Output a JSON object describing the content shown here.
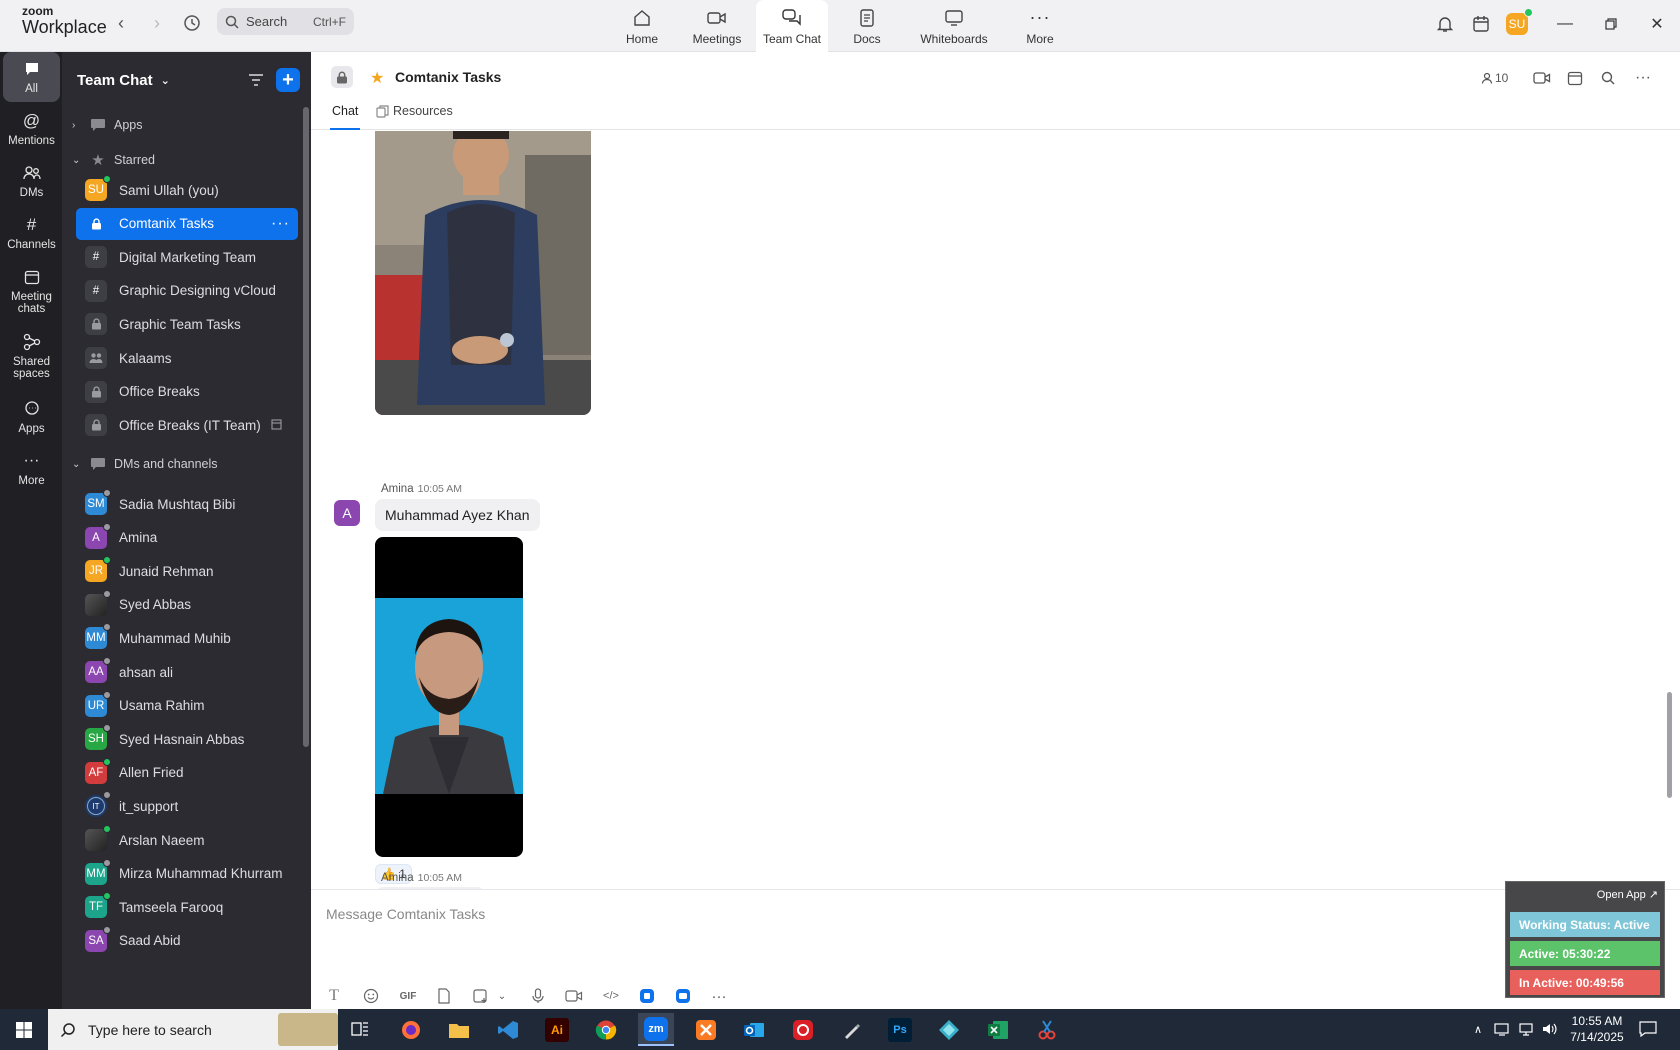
{
  "app": {
    "logo_line1": "zoom",
    "logo_line2": "Workplace"
  },
  "search": {
    "placeholder": "Search",
    "shortcut": "Ctrl+F"
  },
  "top_tabs": [
    {
      "label": "Home",
      "icon": "home-icon"
    },
    {
      "label": "Meetings",
      "icon": "video-camera-icon"
    },
    {
      "label": "Team Chat",
      "icon": "chat-bubbles-icon",
      "active": true
    },
    {
      "label": "Docs",
      "icon": "document-icon"
    },
    {
      "label": "Whiteboards",
      "icon": "whiteboard-icon"
    },
    {
      "label": "More",
      "icon": "more-dots-icon"
    }
  ],
  "user": {
    "initials": "SU",
    "color": "#f5a623",
    "status_color": "#22c55e"
  },
  "rail": [
    {
      "label": "All",
      "active": true
    },
    {
      "label": "Mentions"
    },
    {
      "label": "DMs"
    },
    {
      "label": "Channels"
    },
    {
      "label": "Meeting chats"
    },
    {
      "label": "Shared spaces"
    },
    {
      "label": "Apps"
    },
    {
      "label": "More"
    }
  ],
  "sidebar": {
    "title": "Team Chat",
    "sections": {
      "apps": "Apps",
      "starred": "Starred",
      "dms": "DMs and channels"
    },
    "starred": [
      {
        "label": "Sami Ullah (you)",
        "initials": "SU",
        "color": "#f5a623",
        "type": "user",
        "status": "online"
      },
      {
        "label": "Comtanix Tasks",
        "type": "private",
        "active": true
      },
      {
        "label": "Digital Marketing Team",
        "type": "channel"
      },
      {
        "label": "Graphic Designing vCloud",
        "type": "channel"
      },
      {
        "label": "Graphic Team Tasks",
        "type": "private"
      },
      {
        "label": "Kalaams",
        "type": "group"
      },
      {
        "label": "Office Breaks",
        "type": "private"
      },
      {
        "label": "Office Breaks (IT Team)",
        "type": "private",
        "archived": true
      }
    ],
    "dms": [
      {
        "label": "Sadia Mushtaq Bibi",
        "initials": "SM",
        "color": "#2f8ad6",
        "status": "away"
      },
      {
        "label": "Amina",
        "initials": "A",
        "color": "#8b46b0",
        "status": "away"
      },
      {
        "label": "Junaid Rehman",
        "initials": "JR",
        "color": "#f5a623",
        "status": "online"
      },
      {
        "label": "Syed Abbas",
        "initials": "",
        "color": "#3a3a3a",
        "status": "away",
        "photo": true
      },
      {
        "label": "Muhammad Muhib",
        "initials": "MM",
        "color": "#2f8ad6",
        "status": "away"
      },
      {
        "label": "ahsan ali",
        "initials": "AA",
        "color": "#8b46b0",
        "status": "away"
      },
      {
        "label": "Usama Rahim",
        "initials": "UR",
        "color": "#2f8ad6",
        "status": "away"
      },
      {
        "label": "Syed Hasnain Abbas",
        "initials": "SH",
        "color": "#28a745",
        "status": "away"
      },
      {
        "label": "Allen Fried",
        "initials": "AF",
        "color": "#d23c3c",
        "status": "online"
      },
      {
        "label": "it_support",
        "initials": "IT",
        "color": "#1e3a6e",
        "status": "away",
        "photo": true
      },
      {
        "label": "Arslan Naeem",
        "initials": "",
        "color": "#3a3a3a",
        "status": "online",
        "photo": true
      },
      {
        "label": "Mirza Muhammad Khurram",
        "initials": "MM",
        "color": "#1ca58a",
        "status": "away"
      },
      {
        "label": "Tamseela Farooq",
        "initials": "TF",
        "color": "#1ca58a",
        "status": "online"
      },
      {
        "label": "Saad Abid",
        "initials": "SA",
        "color": "#8b46b0",
        "status": "away"
      }
    ]
  },
  "chat": {
    "title": "Comtanix Tasks",
    "member_count": "10",
    "tabs": [
      "Chat",
      "Resources"
    ],
    "messages": [
      {
        "sender": "Amina",
        "time": "10:05 AM",
        "initial": "A",
        "text": "Muhammad Ayez Khan",
        "reaction": {
          "emoji": "👍",
          "count": "1"
        }
      },
      {
        "sender": "Amina",
        "time": "10:05 AM"
      }
    ],
    "composer_placeholder": "Message Comtanix Tasks"
  },
  "status_widget": {
    "open_app": "Open App ↗",
    "working_status": "Working Status: Active",
    "active": "Active: 05:30:22",
    "inactive": "In Active: 00:49:56",
    "colors": {
      "working": "#7fc6d8",
      "active": "#5cc36a",
      "inactive": "#e8605c"
    }
  },
  "taskbar": {
    "search_placeholder": "Type here to search",
    "time": "10:55 AM",
    "date": "7/14/2025",
    "apps": [
      "Ai",
      "zm",
      "Ps"
    ]
  }
}
